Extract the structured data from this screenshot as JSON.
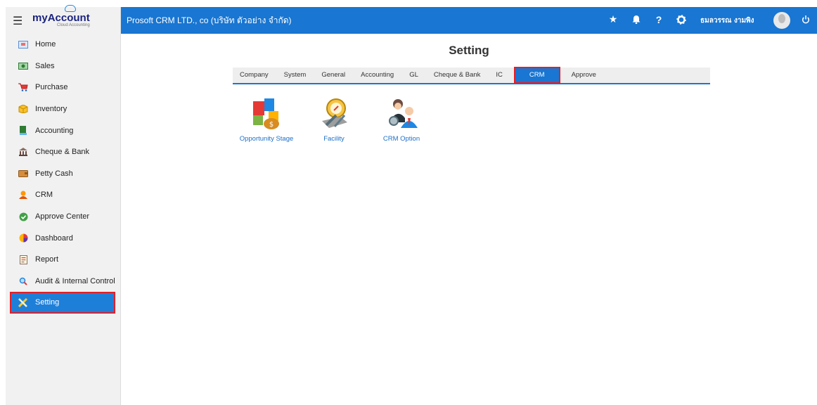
{
  "brand": {
    "name_a": "my",
    "name_b": "Account",
    "tagline": "Cloud Accounting"
  },
  "sidebar": {
    "items": [
      {
        "label": "Home",
        "icon": "home-icon",
        "color": "#5b8fd6"
      },
      {
        "label": "Sales",
        "icon": "sales-icon",
        "color": "#2e7d32"
      },
      {
        "label": "Purchase",
        "icon": "cart-icon",
        "color": "#e53935"
      },
      {
        "label": "Inventory",
        "icon": "box-icon",
        "color": "#f9b000"
      },
      {
        "label": "Accounting",
        "icon": "book-icon",
        "color": "#2e7d32"
      },
      {
        "label": "Cheque & Bank",
        "icon": "bank-icon",
        "color": "#6d4c41"
      },
      {
        "label": "Petty Cash",
        "icon": "wallet-icon",
        "color": "#bf6a1f"
      },
      {
        "label": "CRM",
        "icon": "crm-icon",
        "color": "#e65100"
      },
      {
        "label": "Approve Center",
        "icon": "check-circle-icon",
        "color": "#43a047"
      },
      {
        "label": "Dashboard",
        "icon": "pie-chart-icon",
        "color": "#ef6c00"
      },
      {
        "label": "Report",
        "icon": "report-icon",
        "color": "#8d6e63"
      },
      {
        "label": "Audit & Internal Control",
        "icon": "magnifier-icon",
        "color": "#1e88e5"
      },
      {
        "label": "Setting",
        "icon": "tools-icon",
        "color": "#ffca28"
      }
    ],
    "active_index": 12
  },
  "topbar": {
    "company": "Prosoft CRM LTD., co (บริษัท ตัวอย่าง จำกัด)",
    "username": "ธมลวรรณ งามพิง",
    "icons": [
      "star-icon",
      "bell-icon",
      "help-icon",
      "gear-icon",
      "power-icon"
    ]
  },
  "main": {
    "title": "Setting",
    "tabs": [
      "Company",
      "System",
      "General",
      "Accounting",
      "GL",
      "Cheque & Bank",
      "IC",
      "CRM",
      "Approve"
    ],
    "active_tab": "CRM",
    "tiles": [
      {
        "label": "Opportunity Stage",
        "icon": "opportunity-stage-icon"
      },
      {
        "label": "Facility",
        "icon": "facility-icon"
      },
      {
        "label": "CRM Option",
        "icon": "crm-option-icon"
      }
    ]
  },
  "colors": {
    "accent": "#1976d2",
    "highlight": "#e0202a",
    "link": "#1e6fc8"
  }
}
